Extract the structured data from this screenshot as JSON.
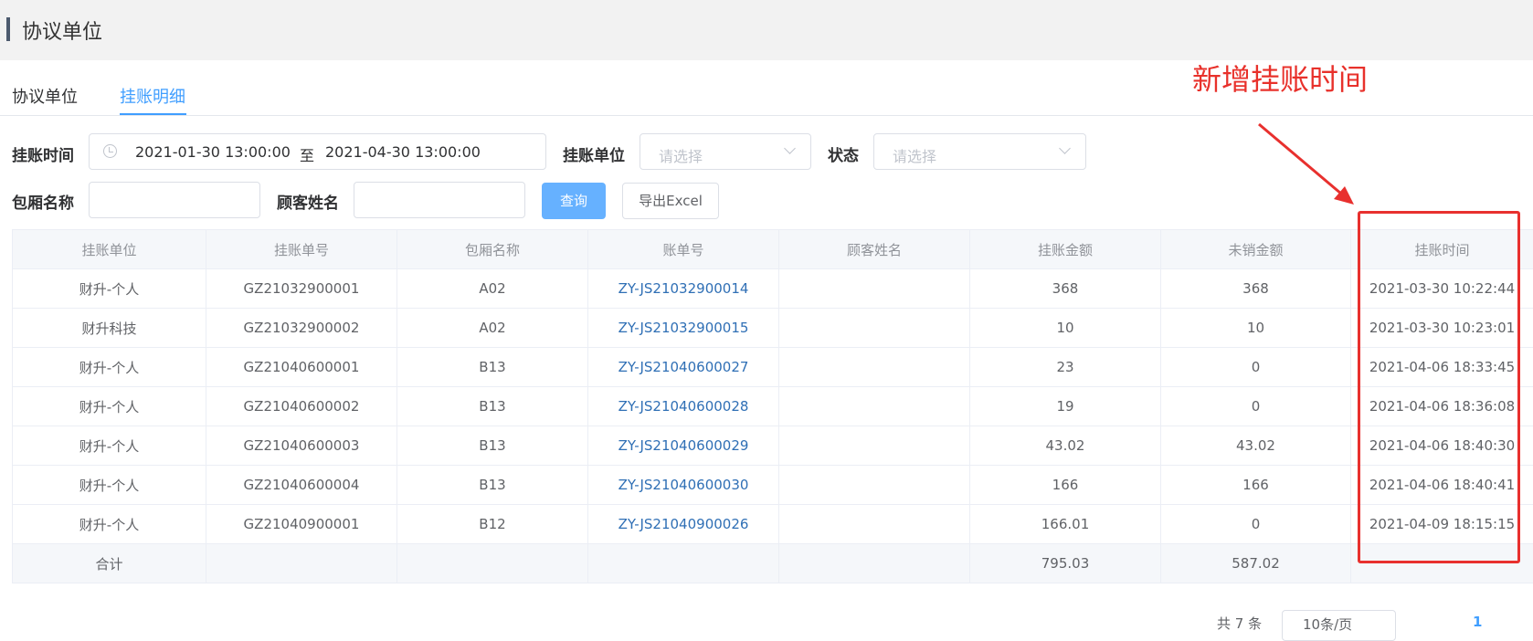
{
  "header": {
    "title": "协议单位"
  },
  "tabs": [
    {
      "label": "协议单位"
    },
    {
      "label": "挂账明细"
    }
  ],
  "filters": {
    "time_label": "挂账时间",
    "start_date": "2021-01-30 13:00:00",
    "range_separator": "至",
    "end_date": "2021-04-30 13:00:00",
    "unit_label": "挂账单位",
    "unit_placeholder": "请选择",
    "status_label": "状态",
    "status_placeholder": "请选择",
    "room_label": "包厢名称",
    "room_value": "",
    "customer_label": "顾客姓名",
    "customer_value": "",
    "query_button": "查询",
    "export_button": "导出Excel"
  },
  "table": {
    "columns": [
      "挂账单位",
      "挂账单号",
      "包厢名称",
      "账单号",
      "顾客姓名",
      "挂账金额",
      "未销金额",
      "挂账时间"
    ],
    "rows": [
      [
        "财升-个人",
        "GZ21032900001",
        "A02",
        "ZY-JS21032900014",
        "",
        "368",
        "368",
        "2021-03-30 10:22:44"
      ],
      [
        "财升科技",
        "GZ21032900002",
        "A02",
        "ZY-JS21032900015",
        "",
        "10",
        "10",
        "2021-03-30 10:23:01"
      ],
      [
        "财升-个人",
        "GZ21040600001",
        "B13",
        "ZY-JS21040600027",
        "",
        "23",
        "0",
        "2021-04-06 18:33:45"
      ],
      [
        "财升-个人",
        "GZ21040600002",
        "B13",
        "ZY-JS21040600028",
        "",
        "19",
        "0",
        "2021-04-06 18:36:08"
      ],
      [
        "财升-个人",
        "GZ21040600003",
        "B13",
        "ZY-JS21040600029",
        "",
        "43.02",
        "43.02",
        "2021-04-06 18:40:30"
      ],
      [
        "财升-个人",
        "GZ21040600004",
        "B13",
        "ZY-JS21040600030",
        "",
        "166",
        "166",
        "2021-04-06 18:40:41"
      ],
      [
        "财升-个人",
        "GZ21040900001",
        "B12",
        "ZY-JS21040900026",
        "",
        "166.01",
        "0",
        "2021-04-09 18:15:15"
      ]
    ],
    "summary": [
      "合计",
      "",
      "",
      "",
      "",
      "795.03",
      "587.02",
      ""
    ]
  },
  "annotation": {
    "text": "新增挂账时间",
    "color": "#e8312b"
  },
  "pagination": {
    "total": "共 7 条",
    "page_size": "10条/页",
    "current_page": "1"
  },
  "colors": {
    "accent": "#409eff",
    "link": "#2f6fb5",
    "annotation": "#e8312b"
  }
}
